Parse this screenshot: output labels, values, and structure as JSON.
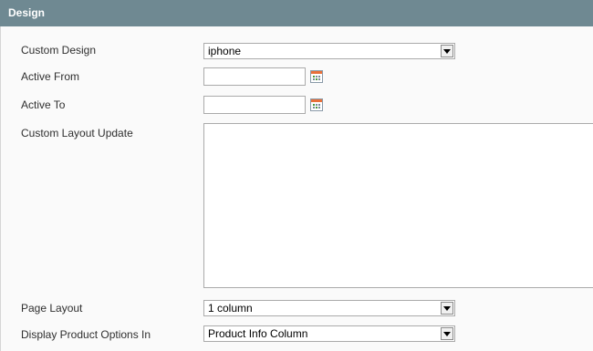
{
  "section": {
    "title": "Design"
  },
  "fields": {
    "custom_design": {
      "label": "Custom Design",
      "value": "iphone"
    },
    "active_from": {
      "label": "Active From",
      "value": ""
    },
    "active_to": {
      "label": "Active To",
      "value": ""
    },
    "custom_layout_update": {
      "label": "Custom Layout Update",
      "value": ""
    },
    "page_layout": {
      "label": "Page Layout",
      "value": "1 column"
    },
    "display_product_options": {
      "label": "Display Product Options In",
      "value": "Product Info Column"
    }
  },
  "icons": {
    "calendar": "calendar-icon",
    "dropdown": "chevron-down-icon"
  },
  "colors": {
    "header_bg": "#6f8992",
    "header_text": "#ffffff",
    "panel_bg": "#fafafa"
  }
}
